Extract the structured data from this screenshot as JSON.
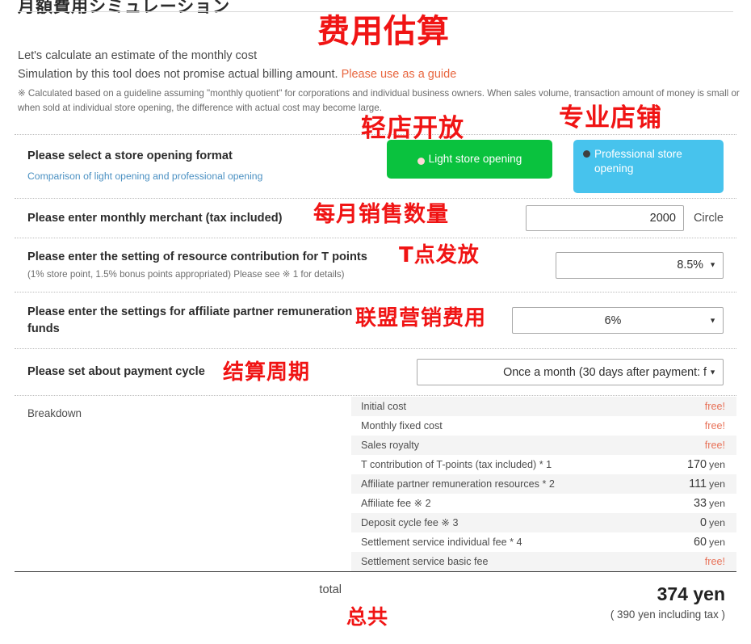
{
  "header": {
    "title": "月額費用シミュレーション",
    "intro_line1": "Let's calculate an estimate of the monthly cost",
    "intro_line2_prefix": "Simulation by this tool does not promise actual billing amount. ",
    "intro_line2_link": "Please use as a guide",
    "notice": "※ Calculated based on a guideline assuming \"monthly quotient\" for corporations and individual business owners. When sales volume, transaction amount of money is small or when sold at individual store opening, the difference with actual cost may become large."
  },
  "form": {
    "store_format": {
      "label": "Please select a store opening format",
      "link": "Comparison of light opening and professional opening",
      "options": [
        {
          "label": "Light store opening",
          "selected": true,
          "color": "#0ac23e"
        },
        {
          "label": "Professional store opening",
          "selected": false,
          "color": "#47c3ed"
        }
      ]
    },
    "monthly_merchant": {
      "label": "Please enter monthly merchant (tax included)",
      "value": "2000",
      "placeholder": "",
      "unit": "Circle"
    },
    "t_points": {
      "label": "Please enter the setting of resource contribution for T points",
      "sub_label": "(1% store point, 1.5% bonus points appropriated) Please see ※ 1 for details)",
      "value": "8.5%"
    },
    "affiliate": {
      "label": "Please enter the settings for affiliate partner remuneration funds",
      "value": "6%"
    },
    "payment_cycle": {
      "label": "Please set about payment cycle",
      "value": "Once a month (30 days after payment: f"
    }
  },
  "breakdown": {
    "label": "Breakdown",
    "rows": [
      {
        "name": "Initial cost",
        "value": "free!",
        "free": true
      },
      {
        "name": "Monthly fixed cost",
        "value": "free!",
        "free": true
      },
      {
        "name": "Sales royalty",
        "value": "free!",
        "free": true
      },
      {
        "name": "T contribution of T-points (tax included) * 1",
        "amount": "170",
        "currency": "yen",
        "free": false
      },
      {
        "name": "Affiliate partner remuneration resources * 2",
        "amount": "111",
        "currency": "yen",
        "free": false
      },
      {
        "name": "Affiliate fee ※ 2",
        "amount": "33",
        "currency": "yen",
        "free": false
      },
      {
        "name": "Deposit cycle fee ※ 3",
        "amount": "0",
        "currency": "yen",
        "free": false
      },
      {
        "name": "Settlement service individual fee * 4",
        "amount": "60",
        "currency": "yen",
        "free": false
      },
      {
        "name": "Settlement service basic fee",
        "value": "free!",
        "free": true
      }
    ]
  },
  "total": {
    "label": "total",
    "amount": "374 yen",
    "tax_note": "( 390 yen including tax )"
  },
  "annotations": {
    "title": "费用估算",
    "professional_store": "专业店铺",
    "light_store": "轻店开放",
    "monthly_sales": "每月销售数量",
    "t_point_issue": "T点发放",
    "affiliate_marketing": "联盟营销费用",
    "settlement_cycle": "结算周期",
    "total": "总共",
    "color": "#f01414"
  }
}
